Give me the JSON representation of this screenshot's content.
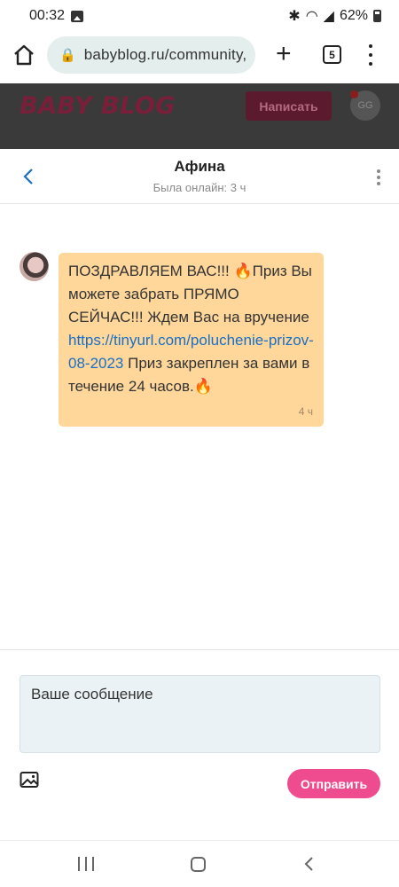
{
  "status_bar": {
    "time": "00:32",
    "battery": "62%"
  },
  "browser": {
    "url": "babyblog.ru/community,",
    "tabs_count": "5"
  },
  "site": {
    "logo": "BABY BLOG",
    "write_label": "Написать",
    "avatar_initials": "GG"
  },
  "chat": {
    "name": "Афина",
    "status": "Была онлайн: 3 ч"
  },
  "message": {
    "text_before_link": "ПОЗДРАВЛЯЕМ ВАС!!! 🔥Приз Вы можете забрать ПРЯМО СЕЙЧАС!!! Ждем Вас на вручение ",
    "link": "https://tinyurl.com/poluchenie-prizov-08-2023",
    "text_after_link": " Приз закреплен за вами в течение 24 часов.🔥",
    "time": "4 ч"
  },
  "composer": {
    "placeholder": "Ваше сообщение",
    "send_label": "Отправить"
  },
  "icons": {
    "home": "home-icon",
    "lock": "lock-icon",
    "plus": "plus-icon",
    "menu": "more-vert-icon",
    "back": "chevron-left-icon",
    "image": "image-icon"
  },
  "colors": {
    "accent": "#ee4c8e",
    "bubble": "#ffd79b",
    "link": "#1a6fc4",
    "header_bg": "#3a3a3a"
  }
}
